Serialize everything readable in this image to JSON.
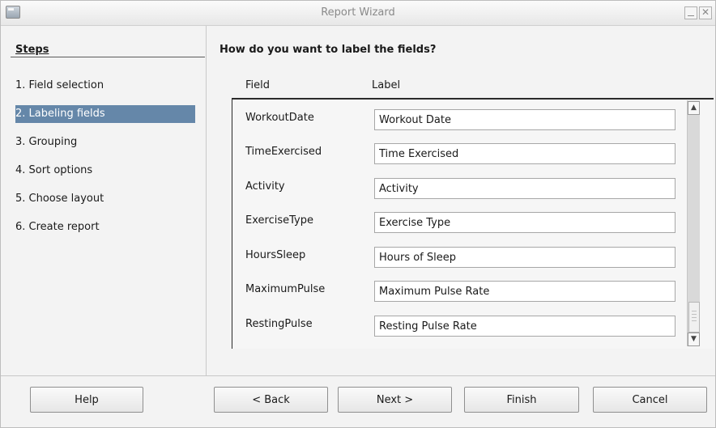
{
  "window": {
    "title": "Report Wizard"
  },
  "sidebar": {
    "title": "Steps",
    "steps": [
      {
        "label": "1. Field selection"
      },
      {
        "label": "2. Labeling fields"
      },
      {
        "label": "3. Grouping"
      },
      {
        "label": "4. Sort options"
      },
      {
        "label": "5. Choose layout"
      },
      {
        "label": "6. Create report"
      }
    ]
  },
  "main": {
    "title": "How do you want to label the fields?",
    "columns": {
      "field": "Field",
      "label": "Label"
    },
    "rows": [
      {
        "field": "WorkoutDate",
        "label": "Workout Date"
      },
      {
        "field": "TimeExercised",
        "label": "Time Exercised"
      },
      {
        "field": "Activity",
        "label": "Activity"
      },
      {
        "field": "ExerciseType",
        "label": "Exercise Type"
      },
      {
        "field": "HoursSleep",
        "label": "Hours of Sleep"
      },
      {
        "field": "MaximumPulse",
        "label": "Maximum Pulse Rate"
      },
      {
        "field": "RestingPulse",
        "label": "Resting Pulse Rate"
      }
    ]
  },
  "buttons": {
    "help": "Help",
    "back": "< Back",
    "next": "Next >",
    "finish": "Finish",
    "cancel": "Cancel"
  }
}
